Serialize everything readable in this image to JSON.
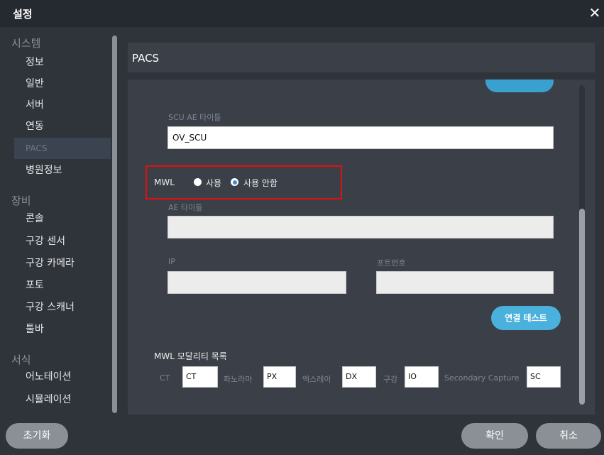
{
  "window": {
    "title": "설정",
    "close_icon": "close-icon"
  },
  "sidebar": {
    "sections": [
      {
        "label": "시스템",
        "items": [
          "정보",
          "일반",
          "서버",
          "연동",
          "PACS",
          "병원정보"
        ]
      },
      {
        "label": "장비",
        "items": [
          "콘솔",
          "구강 센서",
          "구강 카메라",
          "포토",
          "구강 스캐너",
          "툴바"
        ]
      },
      {
        "label": "서식",
        "items": [
          "어노테이션",
          "시뮬레이션"
        ]
      }
    ],
    "active_item": "PACS"
  },
  "header": {
    "title": "PACS"
  },
  "form": {
    "scu_ae_title_label": "SCU AE 타이틀",
    "scu_ae_title_value": "OV_SCU",
    "mwl_label": "MWL",
    "mwl_options": [
      "사용",
      "사용 안함"
    ],
    "mwl_selected": "사용 안함",
    "ae_title_label": "AE 타이틀",
    "ae_title_value": "",
    "ip_label": "IP",
    "ip_value": "",
    "port_label": "포트번호",
    "port_value": "",
    "test_button": "연결 테스트",
    "modality_list_label": "MWL 모달리티 목록",
    "modalities": [
      {
        "label": "CT",
        "value": "CT"
      },
      {
        "label": "파노라마",
        "value": "PX"
      },
      {
        "label": "엑스레이",
        "value": "DX"
      },
      {
        "label": "구강",
        "value": "IO"
      },
      {
        "label": "Secondary Capture",
        "value": "SC"
      }
    ]
  },
  "footer": {
    "reset": "초기화",
    "confirm": "확인",
    "cancel": "취소"
  },
  "colors": {
    "accent": "#4ab0dc",
    "highlight_box": "#e01010",
    "background": "#2f343b",
    "panel": "#3b4048"
  }
}
